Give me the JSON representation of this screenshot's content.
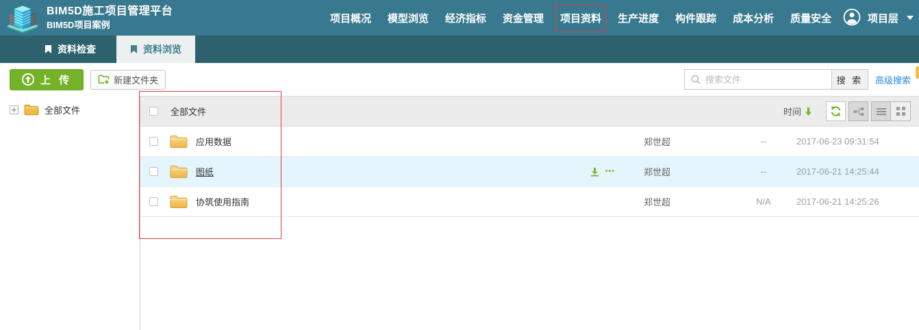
{
  "header": {
    "title": "BIM5D施工项目管理平台",
    "subtitle": "BIM5D项目案例",
    "nav": [
      {
        "label": "项目概况"
      },
      {
        "label": "模型浏览"
      },
      {
        "label": "经济指标"
      },
      {
        "label": "资金管理"
      },
      {
        "label": "项目资料",
        "highlighted": true
      },
      {
        "label": "生产进度"
      },
      {
        "label": "构件跟踪"
      },
      {
        "label": "成本分析"
      },
      {
        "label": "质量安全"
      }
    ],
    "user_label": "项目层"
  },
  "tabs": [
    {
      "label": "资料检查",
      "active": false
    },
    {
      "label": "资料浏览",
      "active": true
    }
  ],
  "toolbar": {
    "upload_label": "上 传",
    "new_folder_label": "新建文件夹",
    "search_placeholder": "搜索文件",
    "search_button_label": "搜 索",
    "advanced_search_label": "高级搜索"
  },
  "sidebar": {
    "root_label": "全部文件"
  },
  "table": {
    "header_label": "全部文件",
    "sort_label": "时间",
    "rows": [
      {
        "name": "应用数据",
        "owner": "郑世超",
        "size": "--",
        "time": "2017-06-23 09:31:54",
        "hovered": false
      },
      {
        "name": "图纸",
        "owner": "郑世超",
        "size": "--",
        "time": "2017-06-21 14:25:44",
        "hovered": true
      },
      {
        "name": "协筑使用指南",
        "owner": "郑世超",
        "size": "N/A",
        "time": "2017-06-21 14:25:26",
        "hovered": false
      }
    ],
    "row_dots": "•••"
  },
  "colors": {
    "header_teal": "#38798f",
    "tabstrip_teal": "#2d616d",
    "accent_green": "#76b72a",
    "link_blue": "#2d8be0",
    "hover_row": "#e4f5fd",
    "annotation_red": "#e03b3b"
  }
}
